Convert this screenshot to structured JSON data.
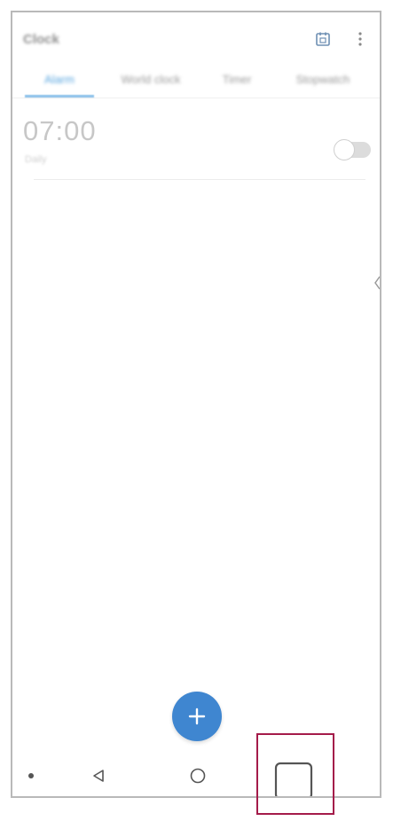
{
  "app": {
    "title": "Clock"
  },
  "toolbar": {
    "icons": [
      "calendar-icon",
      "more-vert-icon"
    ]
  },
  "tabs": [
    {
      "label": "Alarm",
      "active": true
    },
    {
      "label": "World clock",
      "active": false
    },
    {
      "label": "Timer",
      "active": false
    },
    {
      "label": "Stopwatch",
      "active": false
    }
  ],
  "alarm": {
    "time": "07:00",
    "label": "Daily",
    "enabled": false
  },
  "fab": {
    "icon": "plus-icon"
  },
  "navbar": {
    "icons": [
      "back-icon",
      "home-icon",
      "recents-icon"
    ]
  },
  "colors": {
    "accent": "#3f86d0",
    "tab_active": "#5aa6df",
    "highlight": "#a41b4a"
  }
}
